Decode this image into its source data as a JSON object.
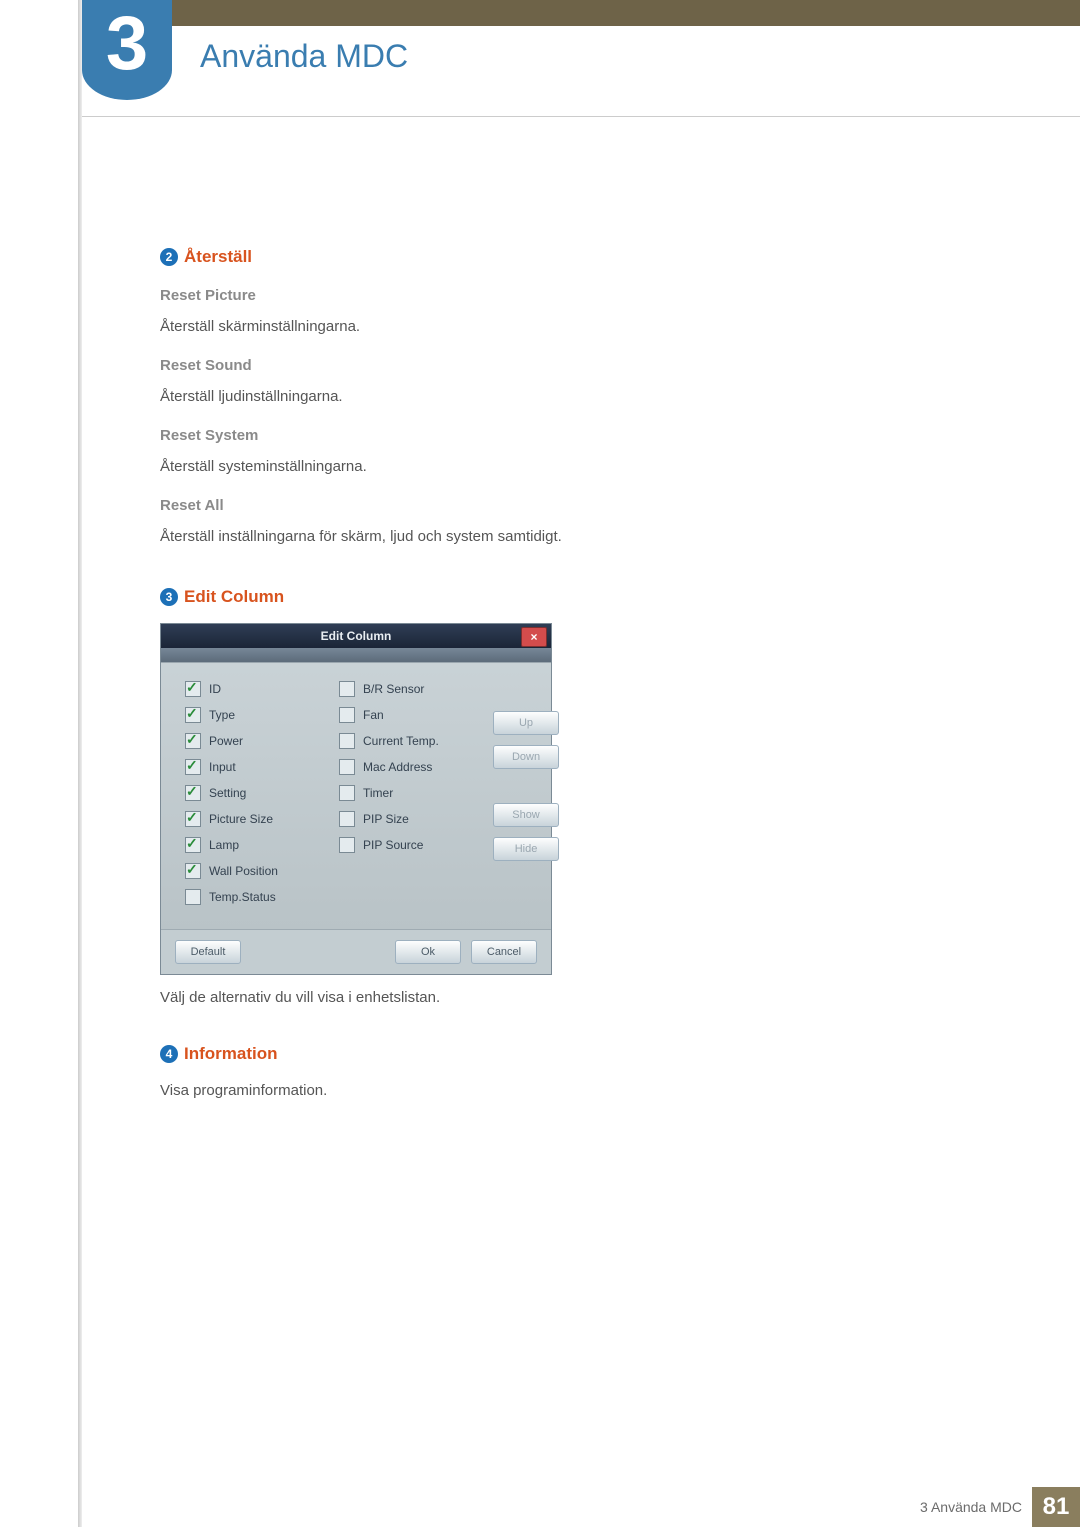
{
  "chapter": {
    "number": "3",
    "title": "Använda MDC"
  },
  "section_reset": {
    "badge": "2",
    "title": "Återställ",
    "items": [
      {
        "h": "Reset Picture",
        "p": "Återställ skärminställningarna."
      },
      {
        "h": "Reset Sound",
        "p": "Återställ ljudinställningarna."
      },
      {
        "h": "Reset System",
        "p": "Återställ systeminställningarna."
      },
      {
        "h": "Reset All",
        "p": "Återställ inställningarna för skärm, ljud och system samtidigt."
      }
    ]
  },
  "section_edit": {
    "badge": "3",
    "title": "Edit Column",
    "caption": "Välj de alternativ du vill visa i enhetslistan."
  },
  "dialog": {
    "title": "Edit Column",
    "close": "×",
    "col1": [
      {
        "label": "ID",
        "checked": true
      },
      {
        "label": "Type",
        "checked": true
      },
      {
        "label": "Power",
        "checked": true
      },
      {
        "label": "Input",
        "checked": true
      },
      {
        "label": "Setting",
        "checked": true
      },
      {
        "label": "Picture Size",
        "checked": true
      },
      {
        "label": "Lamp",
        "checked": true
      },
      {
        "label": "Wall Position",
        "checked": true
      },
      {
        "label": "Temp.Status",
        "checked": false
      }
    ],
    "col2": [
      {
        "label": "B/R Sensor",
        "checked": false
      },
      {
        "label": "Fan",
        "checked": false
      },
      {
        "label": "Current Temp.",
        "checked": false
      },
      {
        "label": "Mac Address",
        "checked": false
      },
      {
        "label": "Timer",
        "checked": false
      },
      {
        "label": "PIP Size",
        "checked": false
      },
      {
        "label": "PIP Source",
        "checked": false
      }
    ],
    "side": {
      "up": "Up",
      "down": "Down",
      "show": "Show",
      "hide": "Hide"
    },
    "footer": {
      "default": "Default",
      "ok": "Ok",
      "cancel": "Cancel"
    }
  },
  "section_info": {
    "badge": "4",
    "title": "Information",
    "p": "Visa programinformation."
  },
  "footer": {
    "label": "3 Använda MDC",
    "page": "81"
  }
}
